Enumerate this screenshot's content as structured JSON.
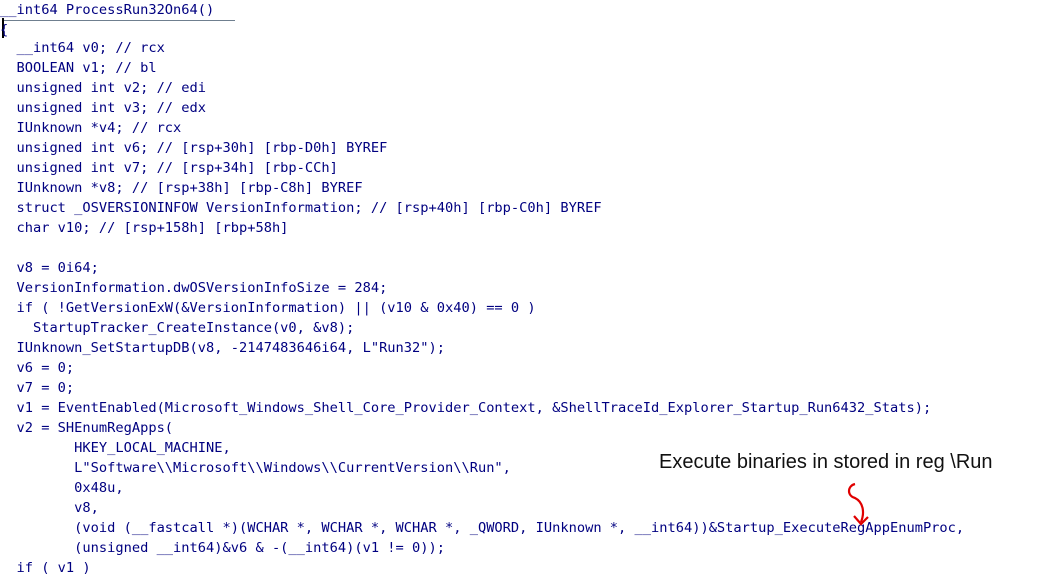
{
  "lines": [
    "__int64 ProcessRun32On64()",
    "{",
    "  __int64 v0; // rcx",
    "  BOOLEAN v1; // bl",
    "  unsigned int v2; // edi",
    "  unsigned int v3; // edx",
    "  IUnknown *v4; // rcx",
    "  unsigned int v6; // [rsp+30h] [rbp-D0h] BYREF",
    "  unsigned int v7; // [rsp+34h] [rbp-CCh]",
    "  IUnknown *v8; // [rsp+38h] [rbp-C8h] BYREF",
    "  struct _OSVERSIONINFOW VersionInformation; // [rsp+40h] [rbp-C0h] BYREF",
    "  char v10; // [rsp+158h] [rbp+58h]",
    "",
    "  v8 = 0i64;",
    "  VersionInformation.dwOSVersionInfoSize = 284;",
    "  if ( !GetVersionExW(&VersionInformation) || (v10 & 0x40) == 0 )",
    "    StartupTracker_CreateInstance(v0, &v8);",
    "  IUnknown_SetStartupDB(v8, -2147483646i64, L\"Run32\");",
    "  v6 = 0;",
    "  v7 = 0;",
    "  v1 = EventEnabled(Microsoft_Windows_Shell_Core_Provider_Context, &ShellTraceId_Explorer_Startup_Run6432_Stats);",
    "  v2 = SHEnumRegApps(",
    "         HKEY_LOCAL_MACHINE,",
    "         L\"Software\\\\Microsoft\\\\Windows\\\\CurrentVersion\\\\Run\",",
    "         0x48u,",
    "         v8,",
    "         (void (__fastcall *)(WCHAR *, WCHAR *, WCHAR *, _QWORD, IUnknown *, __int64))&Startup_ExecuteRegAppEnumProc,",
    "         (unsigned __int64)&v6 & -(__int64)(v1 != 0));",
    "  if ( v1 )"
  ],
  "annotation": "Execute binaries in stored in reg \\Run",
  "colors": {
    "keyword": "#000080",
    "variable": "#0000ff",
    "comment": "#6f7f8f",
    "register": "#6a8aa0",
    "api": "#ff00ff",
    "string": "#008000",
    "arrow": "#e00000"
  }
}
